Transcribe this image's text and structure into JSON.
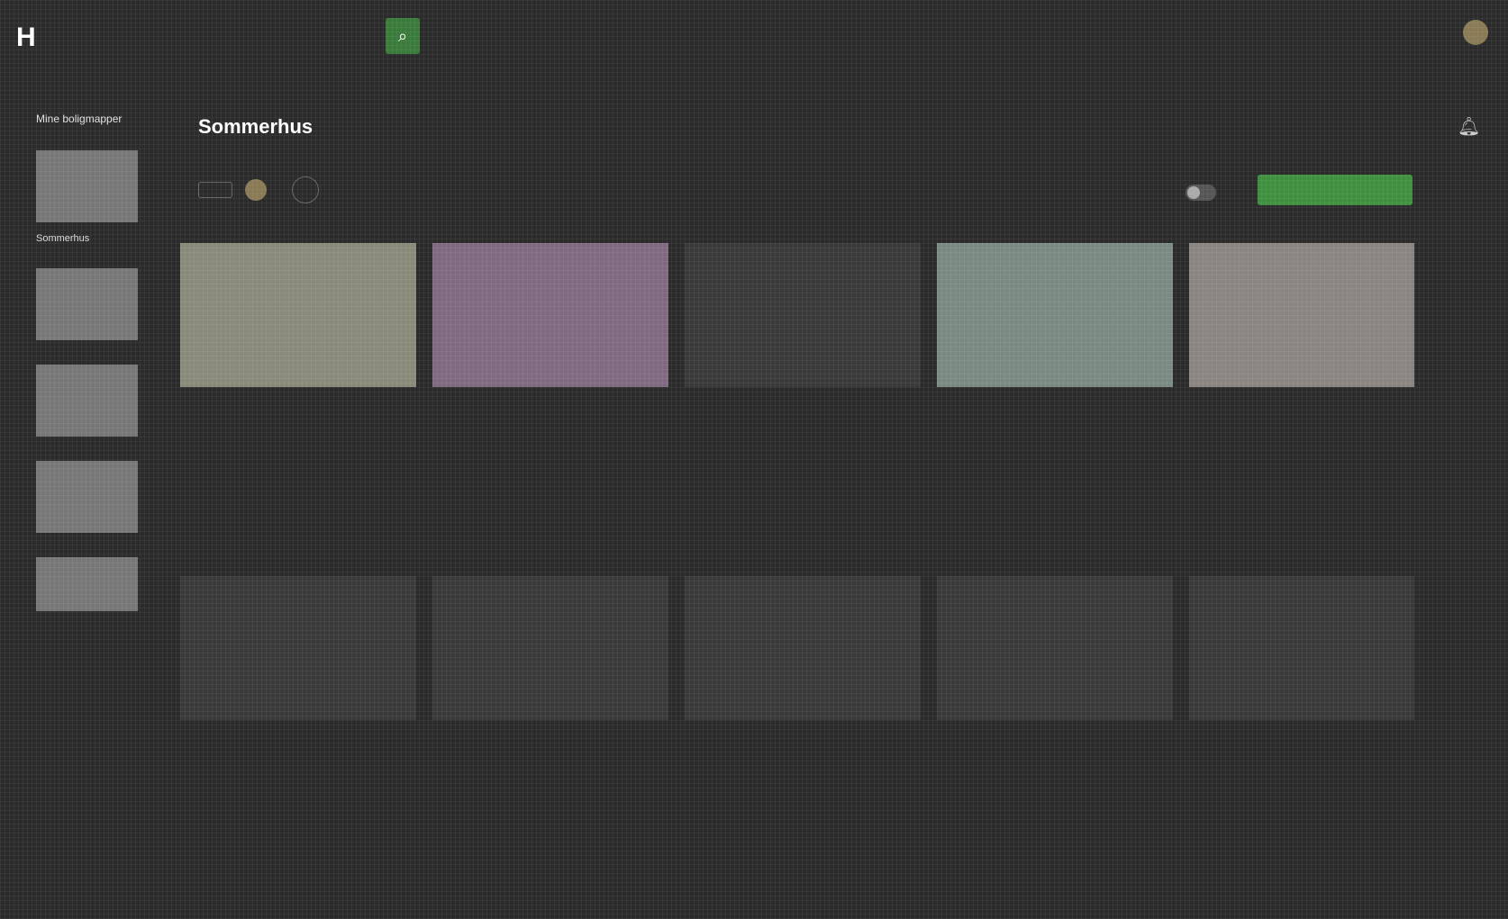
{
  "header": {
    "logo": "H",
    "search_placeholder": "",
    "location_line1": "",
    "location_line2": "",
    "nav": [
      "",
      ""
    ]
  },
  "sidebar": {
    "title": "Mine boligmapper",
    "items": [
      {
        "label": "Sommerhus",
        "count": ""
      },
      {
        "label": "",
        "count": ""
      },
      {
        "label": "",
        "count": ""
      },
      {
        "label": "",
        "count": ""
      },
      {
        "label": "",
        "count": ""
      }
    ],
    "new_label": ""
  },
  "main": {
    "title": "Sommerhus",
    "sort_label": "",
    "invite_label": "",
    "member_more": "",
    "toggle_label": "",
    "compare_label": ""
  },
  "cards": [
    {
      "price": "",
      "change": "",
      "type": "",
      "addr": "",
      "city": "",
      "foot": ""
    },
    {
      "price": "",
      "change": "",
      "type": "",
      "addr": "",
      "city": "",
      "foot": ""
    },
    {
      "price": "",
      "change": "",
      "type": "",
      "addr": "",
      "city": "",
      "foot": ""
    },
    {
      "price": "",
      "change": "",
      "type": "",
      "addr": "",
      "city": "",
      "foot": ""
    },
    {
      "price": "",
      "change": "",
      "type": "",
      "addr": "",
      "city": "",
      "foot": ""
    },
    {
      "price": "",
      "change": "",
      "type": "",
      "addr": "",
      "city": "",
      "foot": ""
    },
    {
      "price": "",
      "change": "",
      "type": "",
      "addr": "",
      "city": "",
      "foot": ""
    },
    {
      "price": "",
      "change": "",
      "type": "",
      "addr": "",
      "city": "",
      "foot": ""
    },
    {
      "price": "",
      "change": "",
      "type": "",
      "addr": "",
      "city": "",
      "foot": ""
    },
    {
      "price": "",
      "change": "",
      "type": "",
      "addr": "",
      "city": "",
      "foot": ""
    }
  ],
  "footer": ""
}
